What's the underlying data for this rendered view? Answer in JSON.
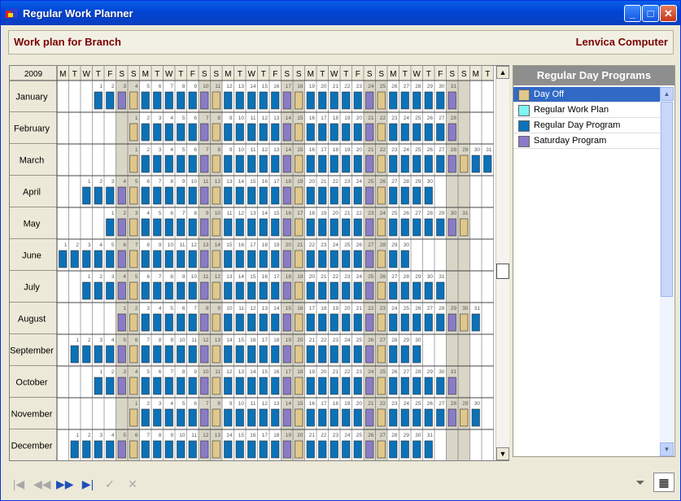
{
  "window": {
    "title": "Regular Work Planner"
  },
  "header": {
    "left": "Work plan for Branch",
    "right": "Lenvica Computer"
  },
  "calendar": {
    "year": "2009",
    "day_headers": [
      "M",
      "T",
      "W",
      "T",
      "F",
      "S",
      "S",
      "M",
      "T",
      "W",
      "T",
      "F",
      "S",
      "S",
      "M",
      "T",
      "W",
      "T",
      "F",
      "S",
      "S",
      "M",
      "T",
      "W",
      "T",
      "F",
      "S",
      "S",
      "M",
      "T",
      "W",
      "T",
      "F",
      "S",
      "S",
      "M",
      "T"
    ],
    "months": [
      {
        "name": "January",
        "start": 3,
        "days": 31
      },
      {
        "name": "February",
        "start": 6,
        "days": 28
      },
      {
        "name": "March",
        "start": 6,
        "days": 31
      },
      {
        "name": "April",
        "start": 2,
        "days": 30
      },
      {
        "name": "May",
        "start": 4,
        "days": 31
      },
      {
        "name": "June",
        "start": 0,
        "days": 30
      },
      {
        "name": "July",
        "start": 2,
        "days": 31
      },
      {
        "name": "August",
        "start": 5,
        "days": 31
      },
      {
        "name": "September",
        "start": 1,
        "days": 30
      },
      {
        "name": "October",
        "start": 3,
        "days": 31
      },
      {
        "name": "November",
        "start": 6,
        "days": 30
      },
      {
        "name": "December",
        "start": 1,
        "days": 31
      }
    ]
  },
  "programs_panel": {
    "title": "Regular Day Programs",
    "items": [
      {
        "label": "Day Off",
        "color": "#E0C78A",
        "selected": true
      },
      {
        "label": "Regular Work Plan",
        "color": "#7FF4F4",
        "selected": false
      },
      {
        "label": "Regular Day Program",
        "color": "#0B72B8",
        "selected": false
      },
      {
        "label": "Saturday Program",
        "color": "#8A7BC7",
        "selected": false
      }
    ]
  },
  "colors": {
    "workday": "#0B72B8",
    "saturday": "#8A7BC7",
    "sunday": "#E0C78A",
    "weekend_col": "#D9D6C7"
  },
  "icons": {
    "first": "first-record-icon",
    "prev": "prev-icon",
    "next": "next-icon",
    "last": "last-record-icon",
    "apply": "check-icon",
    "cancel": "cancel-icon",
    "filter": "filter-icon",
    "calendar": "calendar-grid-icon"
  }
}
